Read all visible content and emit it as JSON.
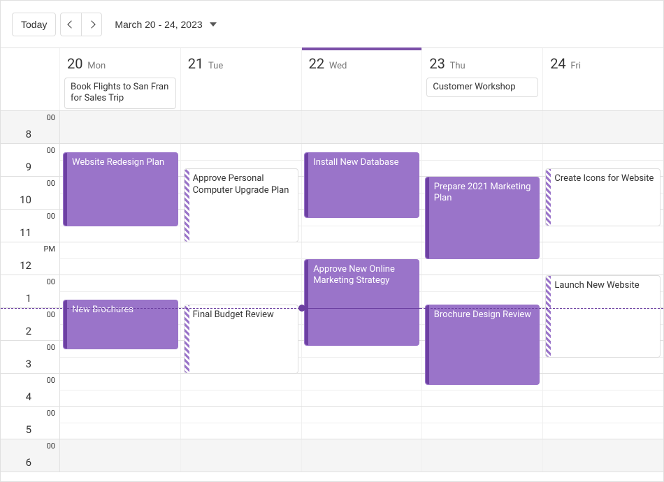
{
  "accent_color": "#9a74c9",
  "toolbar": {
    "today_label": "Today",
    "range_label": "March 20 - 24, 2023"
  },
  "days": [
    {
      "num": "20",
      "dow": "Mon",
      "today": false
    },
    {
      "num": "21",
      "dow": "Tue",
      "today": false
    },
    {
      "num": "22",
      "dow": "Wed",
      "today": true
    },
    {
      "num": "23",
      "dow": "Thu",
      "today": false
    },
    {
      "num": "24",
      "dow": "Fri",
      "today": false
    }
  ],
  "allday": {
    "0": "Book Flights to San Fran for Sales Trip",
    "3": "Customer Workshop"
  },
  "hours": [
    {
      "label": "8",
      "min": "00",
      "alt": true
    },
    {
      "label": "9",
      "min": "00",
      "alt": false
    },
    {
      "label": "10",
      "min": "00",
      "alt": false
    },
    {
      "label": "11",
      "min": "00",
      "alt": false
    },
    {
      "label": "12",
      "min": "PM",
      "alt": false
    },
    {
      "label": "1",
      "min": "00",
      "alt": false
    },
    {
      "label": "2",
      "min": "00",
      "alt": false
    },
    {
      "label": "3",
      "min": "00",
      "alt": false
    },
    {
      "label": "4",
      "min": "00",
      "alt": false
    },
    {
      "label": "5",
      "min": "00",
      "alt": false
    },
    {
      "label": "6",
      "min": "00",
      "alt": true
    }
  ],
  "events": [
    {
      "day": 0,
      "title": "Website Redesign Plan",
      "start_row": 1.25,
      "end_row": 3.5,
      "style": "solid"
    },
    {
      "day": 0,
      "title": "New Brochures",
      "start_row": 5.75,
      "end_row": 7.25,
      "style": "solid"
    },
    {
      "day": 1,
      "title": "Approve Personal Computer Upgrade Plan",
      "start_row": 1.75,
      "end_row": 4.0,
      "style": "outline"
    },
    {
      "day": 1,
      "title": "Final Budget Review",
      "start_row": 5.9,
      "end_row": 8.0,
      "style": "outline"
    },
    {
      "day": 2,
      "title": "Install New Database",
      "start_row": 1.25,
      "end_row": 3.25,
      "style": "solid"
    },
    {
      "day": 2,
      "title": "Approve New Online Marketing Strategy",
      "start_row": 4.5,
      "end_row": 7.15,
      "style": "solid"
    },
    {
      "day": 3,
      "title": "Prepare 2021 Marketing Plan",
      "start_row": 2.0,
      "end_row": 4.5,
      "style": "solid"
    },
    {
      "day": 3,
      "title": "Brochure Design Review",
      "start_row": 5.9,
      "end_row": 8.35,
      "style": "solid"
    },
    {
      "day": 4,
      "title": "Create Icons for Website",
      "start_row": 1.75,
      "end_row": 3.5,
      "style": "outline"
    },
    {
      "day": 4,
      "title": "Launch New Website",
      "start_row": 5.0,
      "end_row": 7.5,
      "style": "outline"
    }
  ],
  "now": {
    "row": 6.0,
    "solid_start_day": 2,
    "solid_end_day": 3
  }
}
